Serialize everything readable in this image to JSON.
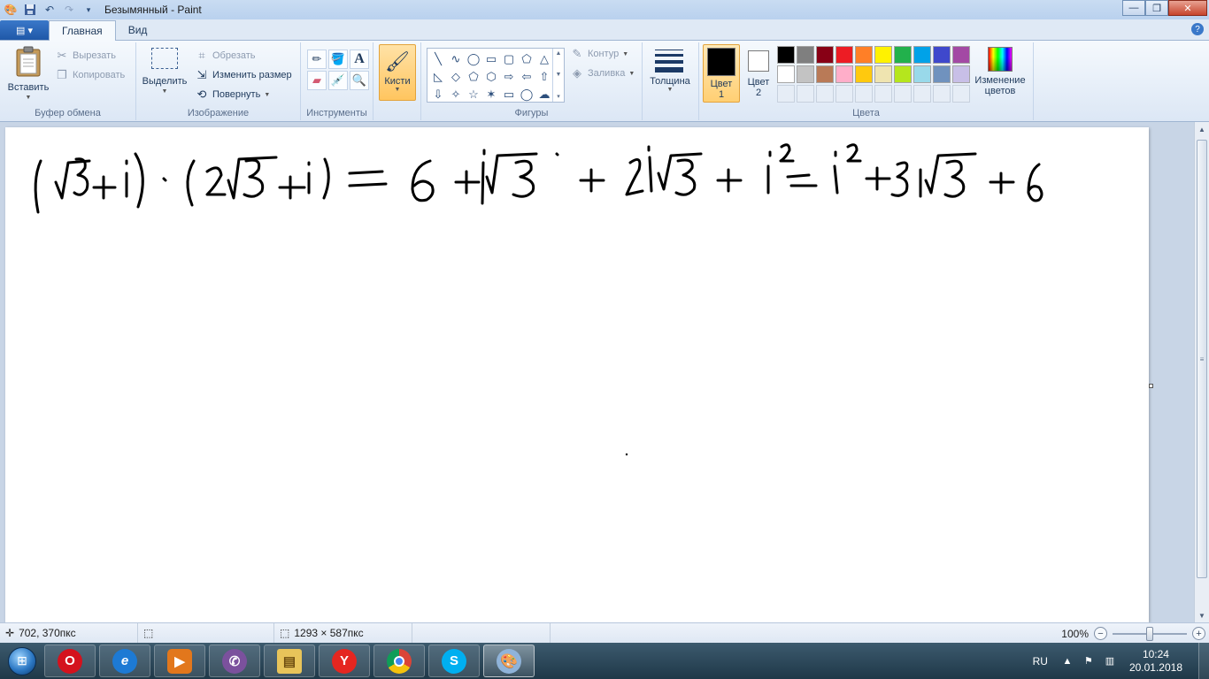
{
  "window": {
    "title": "Безымянный - Paint",
    "min_symbol": "—",
    "max_symbol": "❐",
    "close_symbol": "✕"
  },
  "quick_access": {
    "save_icon": "save-icon",
    "undo_icon": "undo-icon",
    "redo_icon": "redo-icon"
  },
  "tabs": {
    "menu_label": "▤ ▾",
    "home": "Главная",
    "view": "Вид",
    "help": "?"
  },
  "ribbon": {
    "clipboard": {
      "label": "Буфер обмена",
      "paste": "Вставить",
      "cut": "Вырезать",
      "copy": "Копировать"
    },
    "image": {
      "label": "Изображение",
      "select": "Выделить",
      "crop": "Обрезать",
      "resize": "Изменить размер",
      "rotate": "Повернуть"
    },
    "tools": {
      "label": "Инструменты",
      "items": [
        "pencil-icon",
        "fill-icon",
        "text-icon",
        "eraser-icon",
        "color-picker-icon",
        "magnifier-icon"
      ]
    },
    "brushes": {
      "label": "Кисти"
    },
    "shapes": {
      "label": "Фигуры",
      "outline": "Контур",
      "fill": "Заливка",
      "glyphs": [
        "╲",
        "∿",
        "◯",
        "▭",
        "▢",
        "⬠",
        "△",
        "◺",
        "◇",
        "⬠",
        "⬡",
        "⇨",
        "⇦",
        "⇧",
        "⇩",
        "✧",
        "☆",
        "✶",
        "▭",
        "◯",
        "☁"
      ]
    },
    "thickness": {
      "label": "Толщина"
    },
    "color1": {
      "label_line1": "Цвет",
      "label_line2": "1",
      "value": "#000000"
    },
    "color2": {
      "label_line1": "Цвет",
      "label_line2": "2",
      "value": "#ffffff"
    },
    "colors": {
      "label": "Цвета",
      "palette_row1": [
        "#000000",
        "#7f7f7f",
        "#880015",
        "#ed1c24",
        "#ff7f27",
        "#fff200",
        "#22b14c",
        "#00a2e8",
        "#3f48cc",
        "#a349a4"
      ],
      "palette_row2": [
        "#ffffff",
        "#c3c3c3",
        "#b97a57",
        "#ffaec9",
        "#ffc90e",
        "#efe4b0",
        "#b5e61d",
        "#99d9ea",
        "#7092be",
        "#c8bfe7"
      ]
    },
    "edit_colors": {
      "line1": "Изменение",
      "line2": "цветов"
    }
  },
  "status": {
    "cursor_pos": "702, 370пкс",
    "image_size": "1293 × 587пкс",
    "zoom": "100%"
  },
  "taskbar": {
    "apps": [
      "opera-icon",
      "internet-explorer-icon",
      "media-player-icon",
      "viber-icon",
      "file-explorer-icon",
      "yandex-browser-icon",
      "chrome-icon",
      "skype-icon",
      "paint-icon"
    ],
    "language": "RU",
    "time": "10:24",
    "date": "20.01.2018"
  }
}
